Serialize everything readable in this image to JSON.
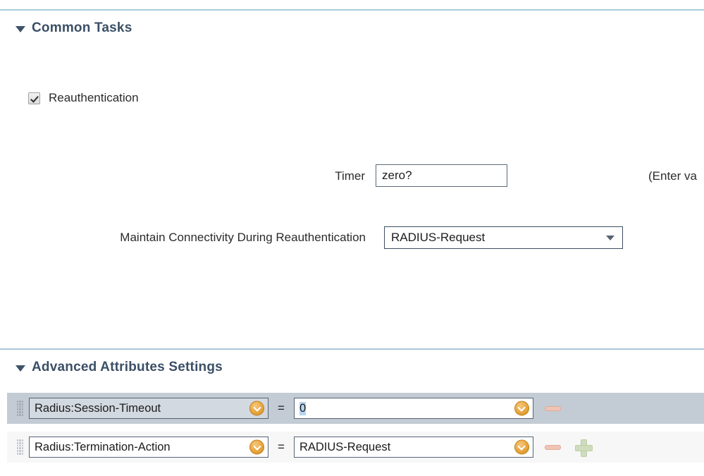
{
  "sections": {
    "common_tasks": {
      "title": "Common Tasks",
      "toggle_icon": "triangle-down-icon",
      "reauthentication": {
        "label": "Reauthentication",
        "checked": true
      },
      "timer": {
        "label": "Timer",
        "value": "zero?",
        "hint": "(Enter va"
      },
      "maintain_connectivity": {
        "label": "Maintain Connectivity During Reauthentication",
        "value": "RADIUS-Request",
        "dropdown_icon": "triangle-down-icon"
      }
    },
    "advanced_attributes": {
      "title": "Advanced Attributes Settings",
      "toggle_icon": "triangle-down-icon",
      "equals_symbol": "=",
      "rows": [
        {
          "grip_icon": "drag-handle-icon",
          "name": "Radius:Session-Timeout",
          "name_picker_icon": "chevron-down-circle-icon",
          "value": "0",
          "value_picker_icon": "chevron-down-circle-icon",
          "value_selected": true,
          "remove_icon": "minus-icon",
          "add_icon": "plus-icon",
          "has_add": false,
          "selected": true
        },
        {
          "grip_icon": "drag-handle-icon",
          "name": "Radius:Termination-Action",
          "name_picker_icon": "chevron-down-circle-icon",
          "value": "RADIUS-Request",
          "value_picker_icon": "chevron-down-circle-icon",
          "value_selected": false,
          "remove_icon": "minus-icon",
          "add_icon": "plus-icon",
          "has_add": true,
          "selected": false
        }
      ]
    }
  },
  "colors": {
    "divider": "#a8cdd9",
    "header_text": "#3b4f66",
    "row_selected_bg": "#c3cbd4",
    "row_plain_bg": "#f7f7f8",
    "picker_gold": "#e8a63f",
    "minus_pink": "#efc4b6",
    "plus_green": "#cfdcbd",
    "text_selection": "#b7d4f2"
  }
}
